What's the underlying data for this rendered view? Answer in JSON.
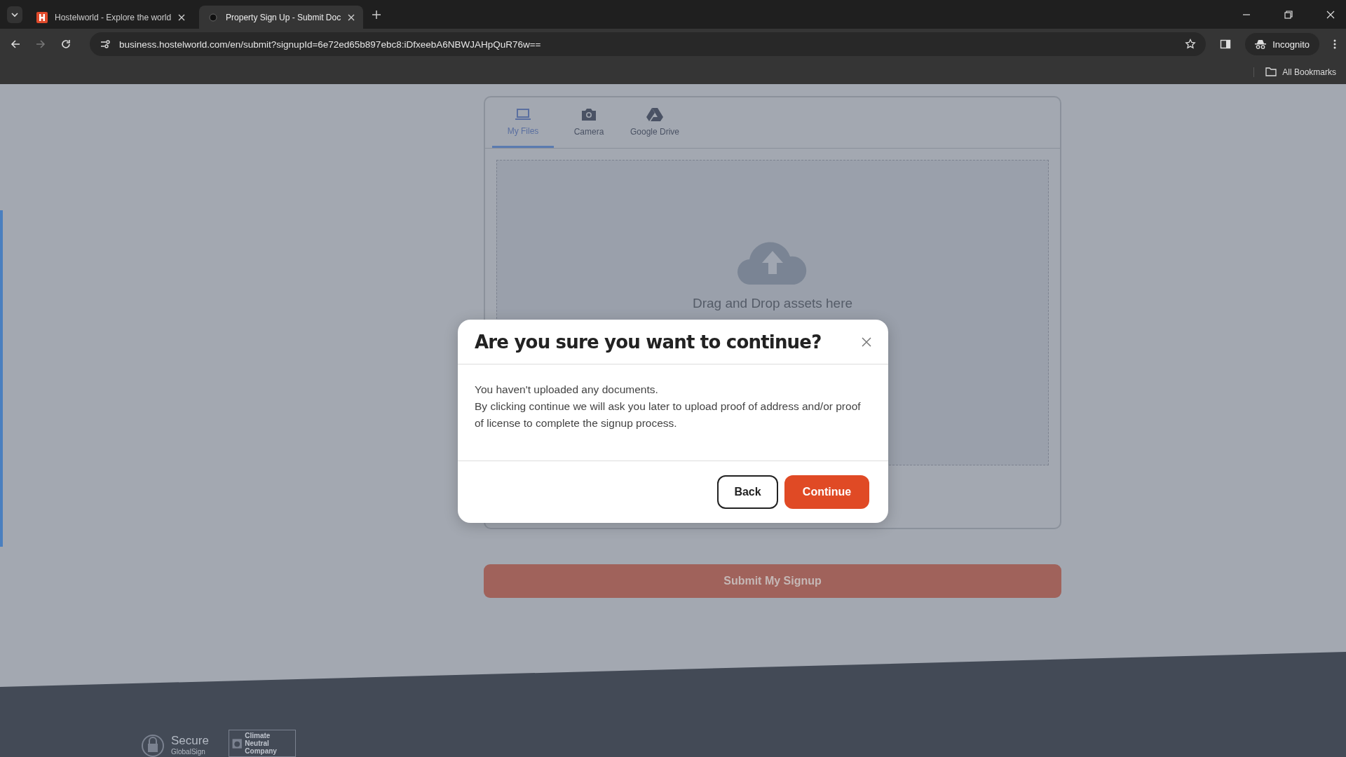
{
  "browser": {
    "tabs": [
      {
        "kind": "site",
        "title": "Hostelworld - Explore the world",
        "selected": false
      },
      {
        "kind": "loading",
        "title": "Property Sign Up - Submit Doc",
        "selected": true
      }
    ],
    "url": "business.hostelworld.com/en/submit?signupId=6e72ed65b897ebc8:iDfxeebA6NBWJAHpQuR76w==",
    "profile": "Incognito",
    "bookmarks": "All Bookmarks"
  },
  "uploader": {
    "tabs": [
      {
        "kind": "files",
        "label": "My Files",
        "selected": true
      },
      {
        "kind": "camera",
        "label": "Camera",
        "selected": false
      },
      {
        "kind": "drive",
        "label": "Google Drive",
        "selected": false
      }
    ],
    "drop_text": "Drag and Drop assets here"
  },
  "submit_button": "Submit My Signup",
  "dialog": {
    "title": "Are you sure you want to continue?",
    "body": [
      "You haven't uploaded any documents.",
      "By clicking continue we will ask you later to upload proof of address and/or proof of license to complete the signup process."
    ],
    "back_button": "Back",
    "continue_button": "Continue"
  },
  "footer": {
    "secure_badge": {
      "title": "Secure",
      "subtitle": "GlobalSign"
    },
    "climate_badge": "Climate Neutral Company"
  }
}
